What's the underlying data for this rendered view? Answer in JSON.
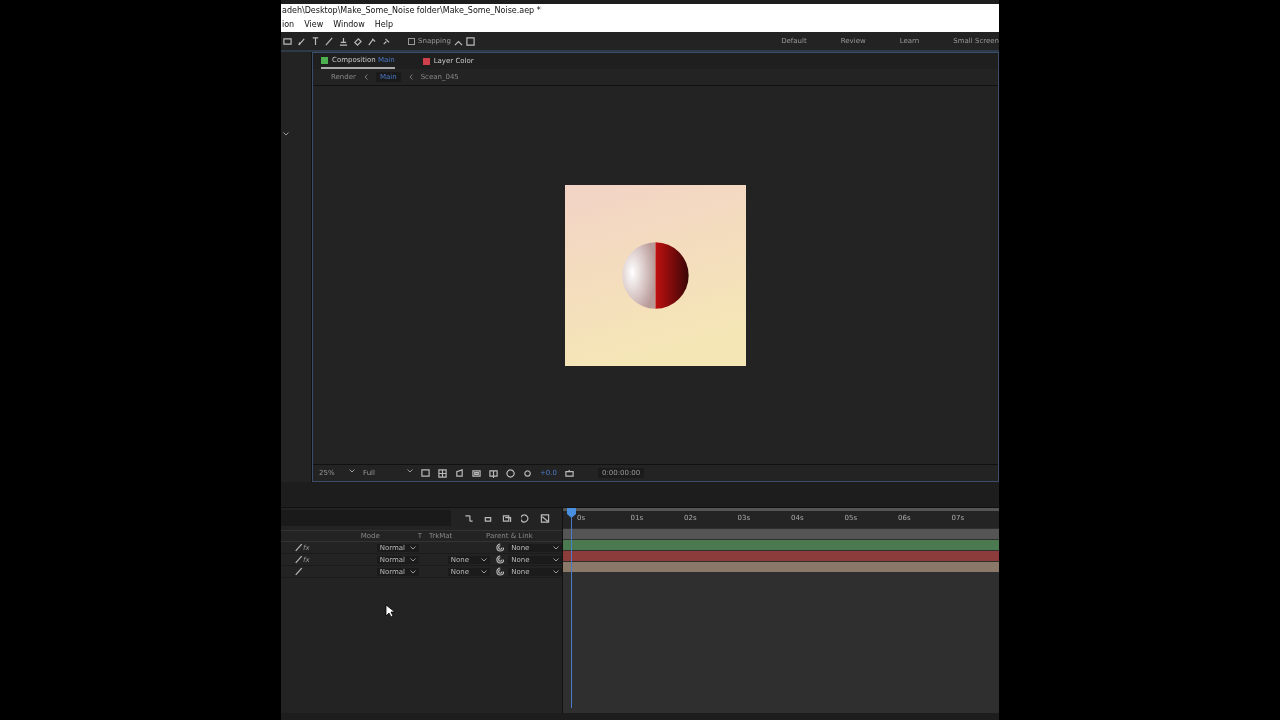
{
  "window": {
    "title": "adeh\\Desktop\\Make_Some_Noise folder\\Make_Some_Noise.aep *"
  },
  "menu": [
    "ion",
    "View",
    "Window",
    "Help"
  ],
  "toolbar": {
    "snapping": {
      "label": "Snapping",
      "checked": false
    }
  },
  "workspaces": [
    "Default",
    "Review",
    "Learn",
    "Small Screen"
  ],
  "composition": {
    "tabs": [
      {
        "label": "Composition",
        "name": "Main",
        "color": "#4caf50",
        "selected": true
      },
      {
        "label": "Layer Color",
        "color": "#d0404a",
        "selected": false
      }
    ],
    "breadcrumbs": [
      {
        "label": "Render",
        "selected": false
      },
      {
        "label": "Main",
        "selected": true
      },
      {
        "label": "Scean_045",
        "selected": false
      }
    ],
    "bottom_bar": {
      "zoom": "25%",
      "resolution": "Full",
      "exposure": "+0.0",
      "timecode": "0:00:00:00"
    }
  },
  "timeline": {
    "columns": [
      "Mode",
      "T",
      "TrkMat",
      "Parent & Link"
    ],
    "layers": [
      {
        "effects": "fx",
        "mode": "Normal",
        "parent": "None",
        "color": "#4c7a50"
      },
      {
        "effects": "fx",
        "mode": "Normal",
        "trkmat": "None",
        "parent": "None",
        "color": "#8c3c3a"
      },
      {
        "mode": "Normal",
        "trkmat": "None",
        "parent": "None",
        "color": "#8a7868"
      }
    ],
    "ruler": [
      "0s",
      "01s",
      "02s",
      "03s",
      "04s",
      "05s",
      "06s",
      "07s"
    ]
  }
}
